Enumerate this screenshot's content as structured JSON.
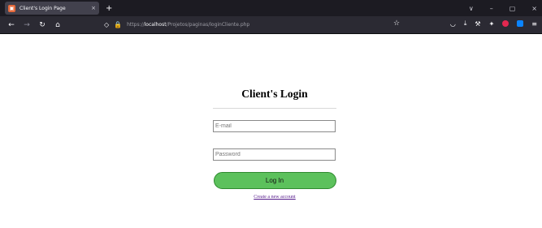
{
  "browser": {
    "tab_title": "Client's Login Page",
    "tab_close": "×",
    "new_tab": "+",
    "url_prefix": "https://",
    "url_host": "localhost",
    "url_path": "/Projetos/paginas/loginCliente.php",
    "window_controls": [
      "∨",
      "–",
      "▢",
      "×"
    ]
  },
  "page": {
    "title": "Client's Login",
    "email_placeholder": "E-mail",
    "password_placeholder": "Password",
    "login_button": "Log In",
    "create_account_link": "Create a new account"
  },
  "colors": {
    "login_button_bg": "#5cc15c",
    "link": "#551a8b"
  }
}
